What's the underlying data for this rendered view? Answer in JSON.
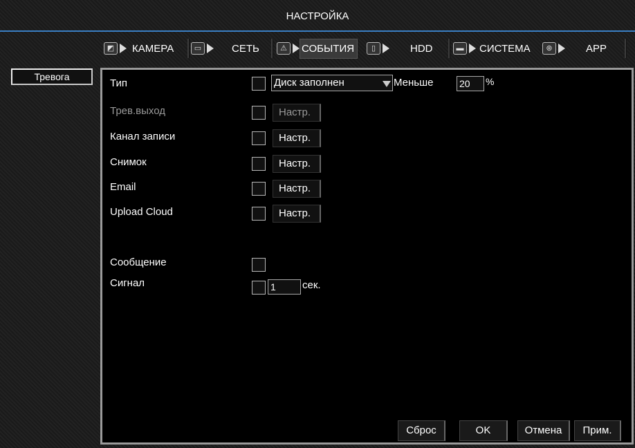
{
  "window": {
    "title": "НАСТРОЙКА"
  },
  "tabs": [
    {
      "label": "КАМЕРА",
      "icon": "camera-icon"
    },
    {
      "label": "СЕТЬ",
      "icon": "network-icon"
    },
    {
      "label": "СОБЫТИЯ",
      "icon": "warning-icon",
      "active": true
    },
    {
      "label": "HDD",
      "icon": "hdd-icon"
    },
    {
      "label": "СИСТЕМА",
      "icon": "monitor-icon"
    },
    {
      "label": "APP",
      "icon": "app-icon"
    }
  ],
  "sidebar": {
    "items": [
      {
        "label": "Тревога"
      }
    ]
  },
  "form": {
    "type_label": "Тип",
    "type_value": "Диск заполнен",
    "less_label": "Меньше",
    "less_value": "20",
    "percent": "%",
    "alarm_out_label": "Трев.выход",
    "record_channel_label": "Канал записи",
    "snapshot_label": "Снимок",
    "email_label": "Email",
    "upload_cloud_label": "Upload Cloud",
    "message_label": "Сообщение",
    "signal_label": "Сигнал",
    "signal_value": "1",
    "signal_unit": "сек.",
    "setup_label": "Настр."
  },
  "buttons": {
    "reset": "Сброс",
    "ok": "OK",
    "cancel": "Отмена",
    "apply": "Прим."
  }
}
